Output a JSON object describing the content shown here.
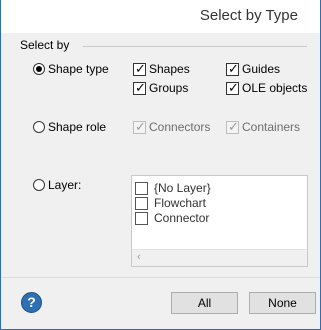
{
  "dialog": {
    "title": "Select by Type"
  },
  "group": {
    "label": "Select by"
  },
  "options": {
    "shape_type": {
      "label": "Shape type",
      "selected": true
    },
    "shape_role": {
      "label": "Shape role",
      "selected": false
    },
    "layer": {
      "label": "Layer:",
      "selected": false
    }
  },
  "shape_types": [
    {
      "label": "Shapes",
      "checked": true
    },
    {
      "label": "Guides",
      "checked": true
    },
    {
      "label": "Groups",
      "checked": true
    },
    {
      "label": "OLE objects",
      "checked": true
    }
  ],
  "shape_roles": [
    {
      "label": "Connectors",
      "checked": true,
      "disabled": true
    },
    {
      "label": "Containers",
      "checked": true,
      "disabled": true
    }
  ],
  "layers": [
    {
      "label": "{No Layer}",
      "checked": false
    },
    {
      "label": "Flowchart",
      "checked": false
    },
    {
      "label": "Connector",
      "checked": false
    }
  ],
  "buttons": {
    "help": "?",
    "all": "All",
    "none": "None"
  },
  "icons": {
    "scroll_left": "‹"
  }
}
